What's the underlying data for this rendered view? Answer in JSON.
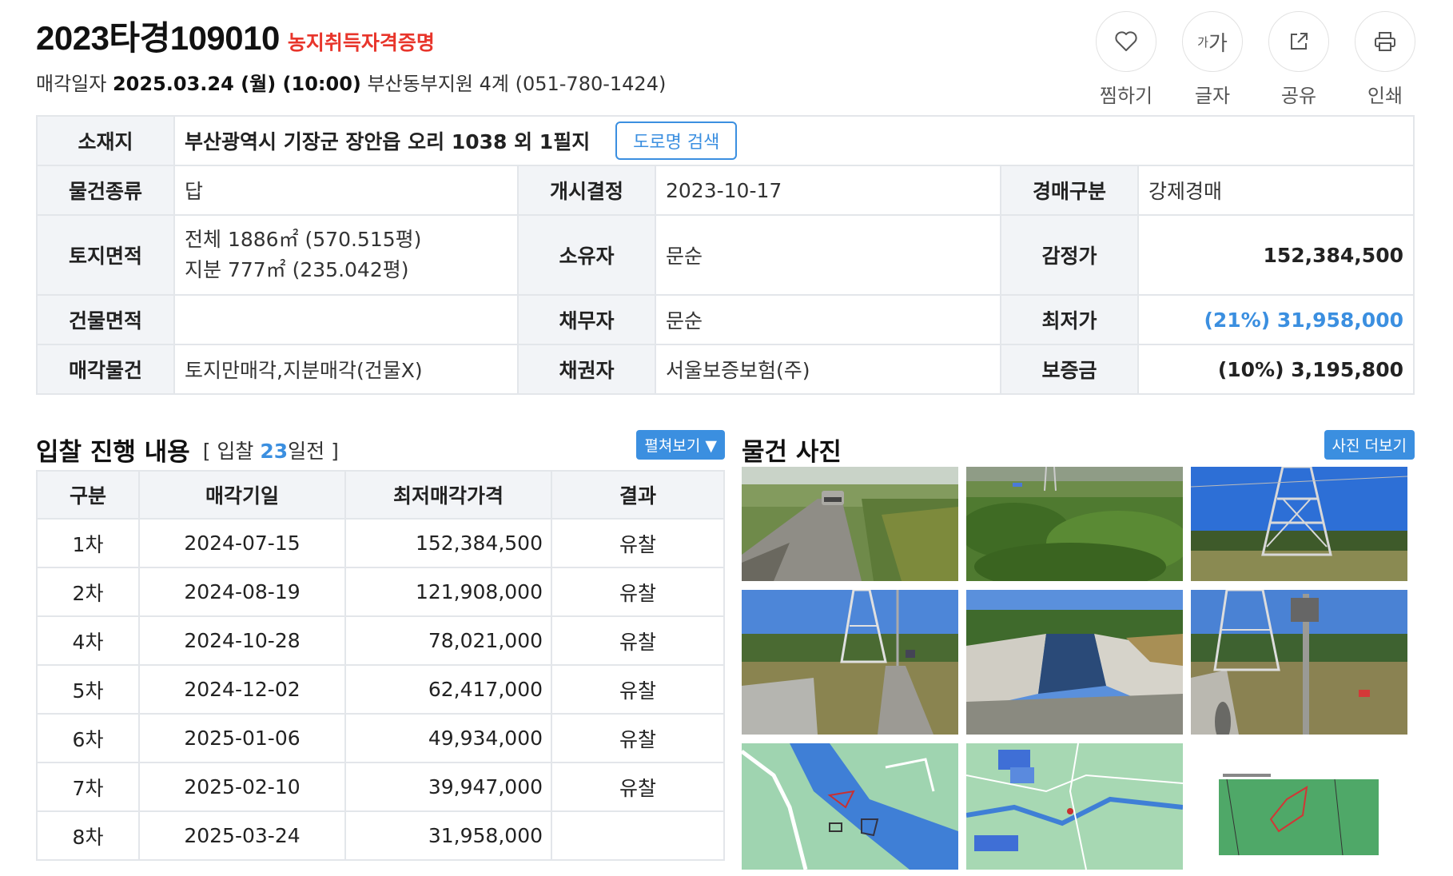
{
  "header": {
    "case_number": "2023타경109010",
    "badge": "농지취득자격증명",
    "sale_prefix": "매각일자",
    "sale_date": "2025.03.24 (월) (10:00)",
    "court": "부산동부지원 4계 (051-780-1424)"
  },
  "actions": [
    {
      "label": "찜하기",
      "icon": "heart-icon"
    },
    {
      "label": "글자",
      "icon": "font-size-icon",
      "glyph_small": "가",
      "glyph_large": "가"
    },
    {
      "label": "공유",
      "icon": "share-icon"
    },
    {
      "label": "인쇄",
      "icon": "print-icon"
    }
  ],
  "info": {
    "location_label": "소재지",
    "location": "부산광역시 기장군 장안읍 오리 1038 외 1필지",
    "road_button": "도로명 검색",
    "type_label": "물건종류",
    "type": "답",
    "start_label": "개시결정",
    "start": "2023-10-17",
    "kind_label": "경매구분",
    "kind": "강제경매",
    "land_label": "토지면적",
    "land_total": "전체 1886㎡ (570.515평)",
    "land_share": "지분 777㎡ (235.042평)",
    "owner_label": "소유자",
    "owner": "문순",
    "appraisal_label": "감정가",
    "appraisal": "152,384,500",
    "building_label": "건물면적",
    "building": "",
    "debtor_label": "채무자",
    "debtor": "문순",
    "minimum_label": "최저가",
    "minimum": "(21%) 31,958,000",
    "sale_item_label": "매각물건",
    "sale_item": "토지만매각,지분매각(건물X)",
    "creditor_label": "채권자",
    "creditor": "서울보증보험(주)",
    "deposit_label": "보증금",
    "deposit": "(10%) 3,195,800"
  },
  "bid": {
    "title": "입찰 진행 내용",
    "sub_open": "[ 입찰 ",
    "days": "23",
    "sub_close": "일전 ]",
    "expand_button": "펼쳐보기 ▼",
    "headers": [
      "구분",
      "매각기일",
      "최저매각가격",
      "결과"
    ],
    "rows": [
      {
        "round": "1차",
        "date": "2024-07-15",
        "price": "152,384,500",
        "result": "유찰"
      },
      {
        "round": "2차",
        "date": "2024-08-19",
        "price": "121,908,000",
        "result": "유찰"
      },
      {
        "round": "4차",
        "date": "2024-10-28",
        "price": "78,021,000",
        "result": "유찰"
      },
      {
        "round": "5차",
        "date": "2024-12-02",
        "price": "62,417,000",
        "result": "유찰"
      },
      {
        "round": "6차",
        "date": "2025-01-06",
        "price": "49,934,000",
        "result": "유찰"
      },
      {
        "round": "7차",
        "date": "2025-02-10",
        "price": "39,947,000",
        "result": "유찰"
      },
      {
        "round": "8차",
        "date": "2025-03-24",
        "price": "31,958,000",
        "result": ""
      }
    ]
  },
  "photos": {
    "title": "물건 사진",
    "more_button": "사진 더보기"
  },
  "colors": {
    "accent": "#3b8fe0",
    "badge_red": "#e8352b",
    "header_cell": "#f2f4f7",
    "border": "#e3e6ea"
  }
}
